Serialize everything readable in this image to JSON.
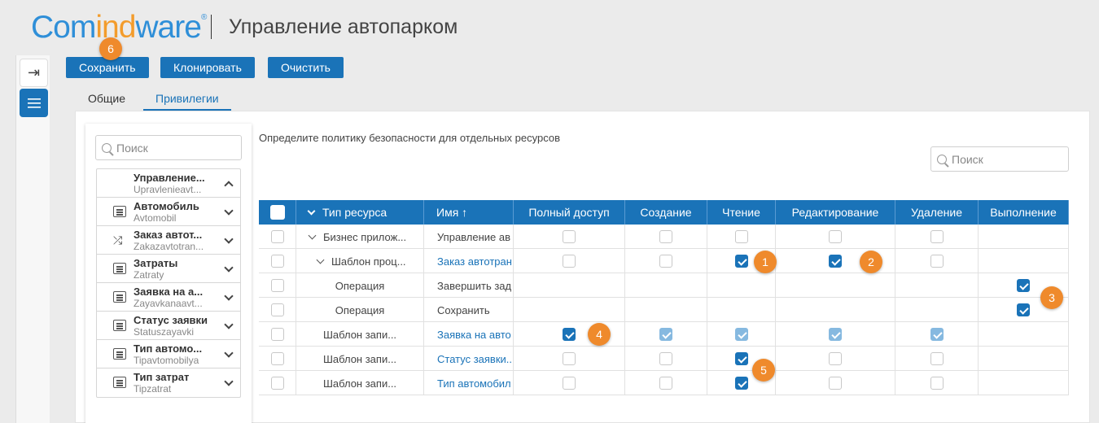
{
  "header": {
    "logo_left": "Com",
    "logo_mid": "ind",
    "logo_right": "ware",
    "logo_reg": "®",
    "title": "Управление автопарком"
  },
  "toolbar": {
    "save": "Сохранить",
    "clone": "Клонировать",
    "clear": "Очистить"
  },
  "tabs": [
    {
      "label": "Общие",
      "active": false
    },
    {
      "label": "Привилегии",
      "active": true
    }
  ],
  "left_panel": {
    "search_placeholder": "Поиск",
    "items": [
      {
        "name": "Управление...",
        "sys": "Upravlenieavt...",
        "icon": "none",
        "expanded": true
      },
      {
        "name": "Автомобиль",
        "sys": "Avtomobil",
        "icon": "list-icon",
        "expanded": false
      },
      {
        "name": "Заказ автот...",
        "sys": "Zakazavtotran...",
        "icon": "shuffle-icon",
        "expanded": false
      },
      {
        "name": "Затраты",
        "sys": "Zatraty",
        "icon": "list-icon",
        "expanded": false
      },
      {
        "name": "Заявка на а...",
        "sys": "Zayavkanaavt...",
        "icon": "list-icon",
        "expanded": false
      },
      {
        "name": "Статус заявки",
        "sys": "Statuszayavki",
        "icon": "list-icon",
        "expanded": false
      },
      {
        "name": "Тип автомо...",
        "sys": "Tipavtomobilya",
        "icon": "list-icon",
        "expanded": false
      },
      {
        "name": "Тип затрат",
        "sys": "Tipzatrat",
        "icon": "list-icon",
        "expanded": false
      }
    ]
  },
  "main": {
    "policy_label": "Определите политику безопасности для отдельных ресурсов",
    "search_placeholder": "Поиск",
    "columns": [
      "Тип ресурса",
      "Имя ↑",
      "Полный доступ",
      "Создание",
      "Чтение",
      "Редактирование",
      "Удаление",
      "Выполнение"
    ],
    "rows": [
      {
        "type": "Бизнес прилож...",
        "type_expand": true,
        "type_indent": 1,
        "name": "Управление ав",
        "name_link": false,
        "perms": [
          "off",
          "off",
          "off",
          "off",
          "off",
          "none"
        ]
      },
      {
        "type": "Шаблон проц...",
        "type_expand": true,
        "type_indent": 2,
        "name": "Заказ автотран",
        "name_link": true,
        "perms": [
          "off",
          "off",
          "on",
          "on",
          "off",
          "none"
        ]
      },
      {
        "type": "Операция",
        "type_expand": false,
        "type_indent": 0,
        "name": "Завершить зад",
        "name_link": false,
        "perms": [
          "none",
          "none",
          "none",
          "none",
          "none",
          "on"
        ]
      },
      {
        "type": "Операция",
        "type_expand": false,
        "type_indent": 0,
        "name": "Сохранить",
        "name_link": false,
        "perms": [
          "none",
          "none",
          "none",
          "none",
          "none",
          "on"
        ]
      },
      {
        "type": "Шаблон запи...",
        "type_expand": false,
        "type_indent": 0,
        "name": "Заявка на авто",
        "name_link": true,
        "perms": [
          "on",
          "light",
          "light",
          "light",
          "light",
          "none"
        ]
      },
      {
        "type": "Шаблон запи...",
        "type_expand": false,
        "type_indent": 0,
        "name": "Статус заявки...",
        "name_link": true,
        "perms": [
          "off",
          "off",
          "on",
          "off",
          "off",
          "none"
        ]
      },
      {
        "type": "Шаблон запи...",
        "type_expand": false,
        "type_indent": 0,
        "name": "Тип автомобил",
        "name_link": true,
        "perms": [
          "off",
          "off",
          "on",
          "off",
          "off",
          "none"
        ]
      }
    ]
  },
  "badges": [
    "6",
    "1",
    "2",
    "3",
    "4",
    "5"
  ],
  "colors": {
    "accent": "#1a73b8",
    "badge": "#ef8a2c",
    "logo_blue": "#2f8fd8",
    "logo_orange": "#f39c2c"
  }
}
